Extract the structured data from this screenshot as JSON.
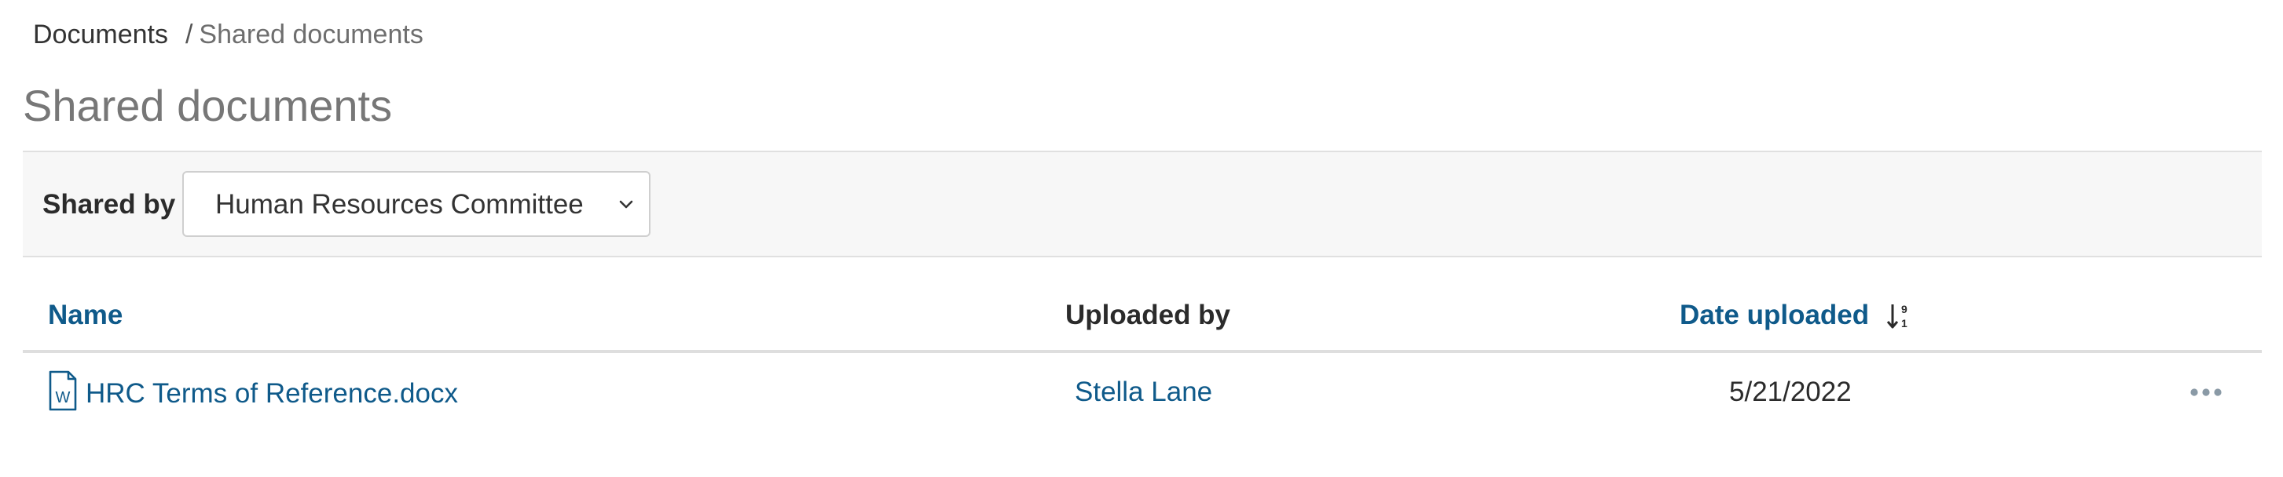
{
  "breadcrumb": {
    "root": "Documents",
    "separator": "/",
    "current": "Shared documents"
  },
  "page": {
    "title": "Shared documents"
  },
  "filter": {
    "label": "Shared by",
    "selected": "Human Resources Committee",
    "icon": "chevron-down-icon"
  },
  "table": {
    "columns": {
      "name": "Name",
      "uploaded_by": "Uploaded by",
      "date_uploaded": "Date uploaded"
    },
    "sort_icon": "sort-numeric-ascending-icon",
    "rows": [
      {
        "file_icon": "word-document-icon",
        "file_icon_letter": "W",
        "name": "HRC Terms of Reference.docx",
        "uploaded_by": "Stella Lane",
        "date": "5/21/2022",
        "actions_icon": "more-horizontal-icon"
      }
    ]
  },
  "colors": {
    "link": "#0f5a8a",
    "title": "#777777",
    "filter_bar_bg": "#f7f7f7",
    "border": "#e0e0e0"
  }
}
